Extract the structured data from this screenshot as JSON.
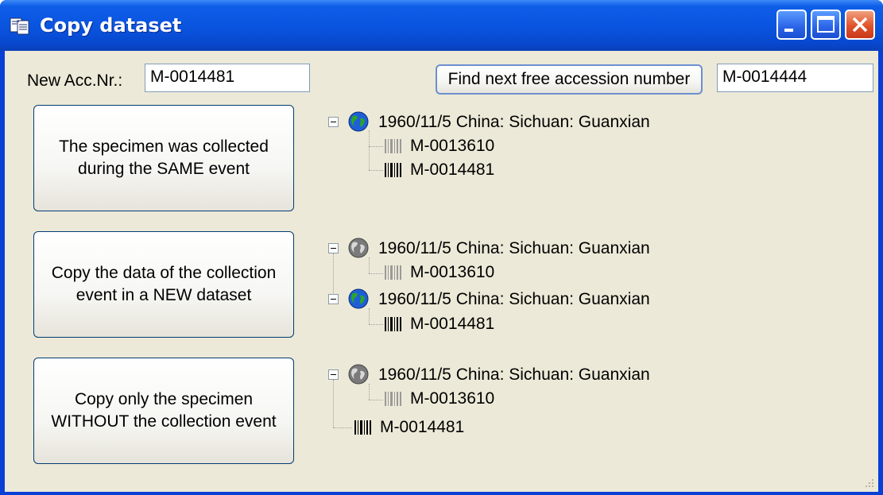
{
  "window": {
    "title": "Copy dataset"
  },
  "acc": {
    "label": "New Acc.Nr.:",
    "value": "M-0014481"
  },
  "find": {
    "button_label": "Find next free accession number",
    "value": "M-0014444"
  },
  "options": [
    {
      "label": "The specimen was collected during the SAME event"
    },
    {
      "label": "Copy the data of the collection event in a NEW dataset"
    },
    {
      "label": "Copy only the specimen WITHOUT the collection event"
    }
  ],
  "tree1": {
    "event": "1960/11/5 China: Sichuan: Guanxian",
    "existing": "M-0013610",
    "new": "M-0014481"
  },
  "tree2": {
    "event_old": "1960/11/5 China: Sichuan: Guanxian",
    "existing": "M-0013610",
    "event_new": "1960/11/5 China: Sichuan: Guanxian",
    "new": "M-0014481"
  },
  "tree3": {
    "event": "1960/11/5 China: Sichuan: Guanxian",
    "existing": "M-0013610",
    "new": "M-0014481"
  },
  "colors": {
    "title_blue": "#0a55e0",
    "client_bg": "#ece9d8",
    "close_red": "#e0532a",
    "globe_green": "#2aa52a",
    "globe_blue": "#1f5fd6"
  }
}
